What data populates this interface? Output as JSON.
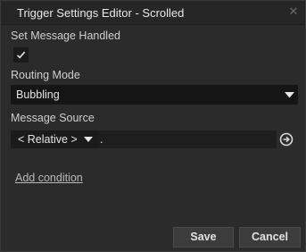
{
  "window": {
    "title": "Trigger Settings Editor - Scrolled",
    "close_glyph": "✕"
  },
  "fields": {
    "set_message_handled": {
      "label": "Set Message Handled",
      "checked": true
    },
    "routing_mode": {
      "label": "Routing Mode",
      "value": "Bubbling"
    },
    "message_source": {
      "label": "Message Source",
      "mode": "< Relative >",
      "path": "."
    }
  },
  "add_condition_label": "Add condition",
  "buttons": {
    "save": "Save",
    "cancel": "Cancel"
  },
  "colors": {
    "background": "#2b2b2b",
    "input_background": "#151515",
    "text": "#d6d6d6"
  },
  "icons": {
    "close": "close-icon",
    "checkmark": "checkmark-icon",
    "dropdown": "chevron-down-icon",
    "goto": "arrow-right-circle-icon"
  }
}
